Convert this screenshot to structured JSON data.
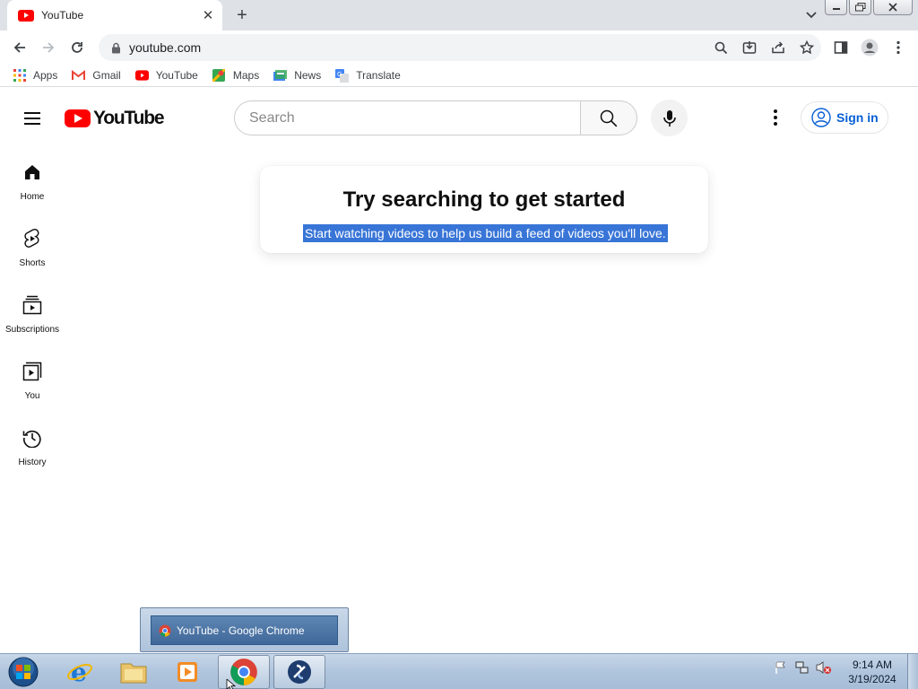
{
  "browser": {
    "tab_title": "YouTube",
    "new_tab_label": "+",
    "url": "youtube.com"
  },
  "bookmarks": [
    {
      "label": "Apps",
      "icon": "apps-grid-icon"
    },
    {
      "label": "Gmail",
      "icon": "gmail-icon"
    },
    {
      "label": "YouTube",
      "icon": "youtube-icon"
    },
    {
      "label": "Maps",
      "icon": "maps-icon"
    },
    {
      "label": "News",
      "icon": "news-icon"
    },
    {
      "label": "Translate",
      "icon": "translate-icon"
    }
  ],
  "youtube": {
    "logo_text": "YouTube",
    "search_placeholder": "Search",
    "sign_in_label": "Sign in",
    "guide": [
      {
        "label": "Home",
        "icon": "home-icon"
      },
      {
        "label": "Shorts",
        "icon": "shorts-icon"
      },
      {
        "label": "Subscriptions",
        "icon": "subscriptions-icon"
      },
      {
        "label": "You",
        "icon": "you-icon"
      },
      {
        "label": "History",
        "icon": "history-icon"
      }
    ],
    "promo": {
      "title": "Try searching to get started",
      "subtitle": "Start watching videos to help us build a feed of videos you'll love."
    },
    "colors": {
      "brand_red": "#ff0000",
      "link_blue": "#065fd4",
      "selection": "#3875d7"
    }
  },
  "taskbar": {
    "thumbnail_label": "YouTube - Google Chrome",
    "time": "9:14 AM",
    "date": "3/19/2024"
  }
}
